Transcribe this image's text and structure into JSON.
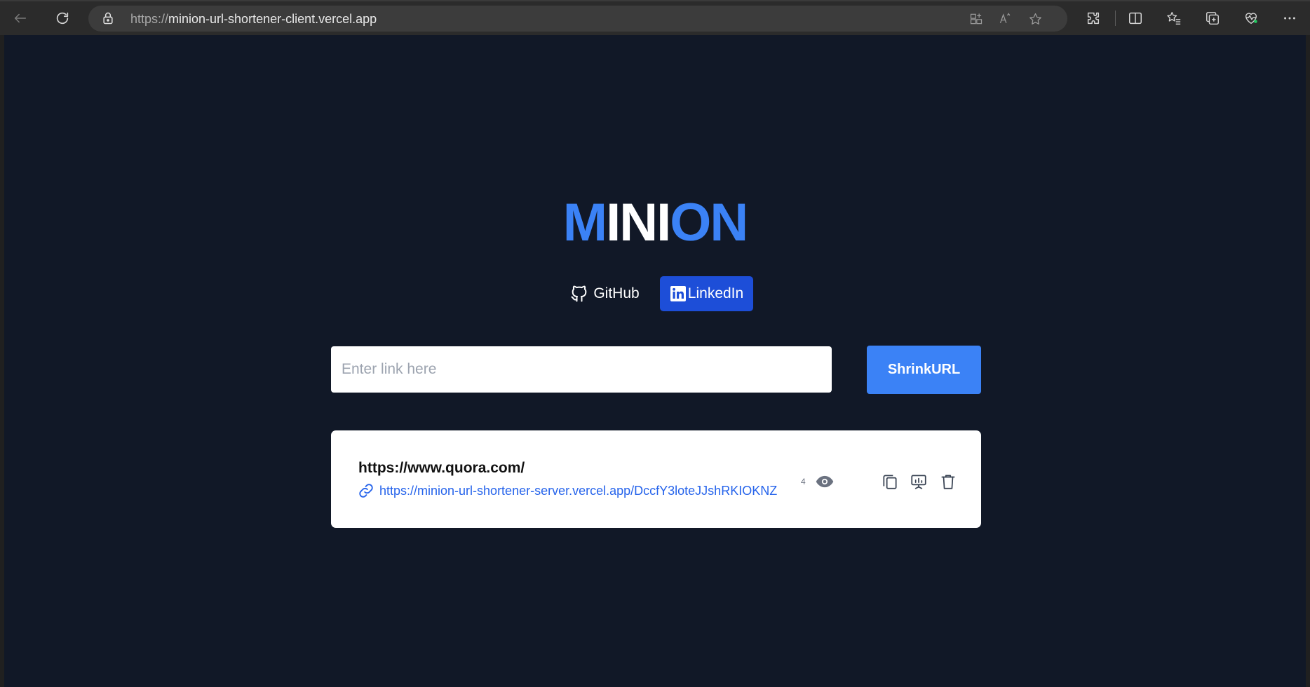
{
  "browser": {
    "url_scheme": "https://",
    "url_host": "minion-url-shortener-client.vercel.app",
    "icons": [
      "back-icon",
      "refresh-icon",
      "lock-icon",
      "app-grid-icon",
      "read-aloud-icon",
      "favorite-star-icon",
      "extensions-icon",
      "split-screen-icon",
      "favorites-icon",
      "collections-icon",
      "browser-essentials-icon",
      "more-icon"
    ]
  },
  "header": {
    "logo_part1": "M",
    "logo_part2": "INI",
    "logo_part3": "ON"
  },
  "social": {
    "github_label": "GitHub",
    "linkedin_label": "LinkedIn"
  },
  "form": {
    "placeholder": "Enter link here",
    "value": "",
    "button_label": "ShrinkURL"
  },
  "results": [
    {
      "original_url": "https://www.quora.com/",
      "short_url": "https://minion-url-shortener-server.vercel.app/DccfY3loteJJshRKIOKNZ",
      "visits": "4"
    }
  ],
  "colors": {
    "page_bg": "#111827",
    "accent": "#3b82f6",
    "linkedin": "#1d4ed8",
    "link": "#2563eb"
  }
}
